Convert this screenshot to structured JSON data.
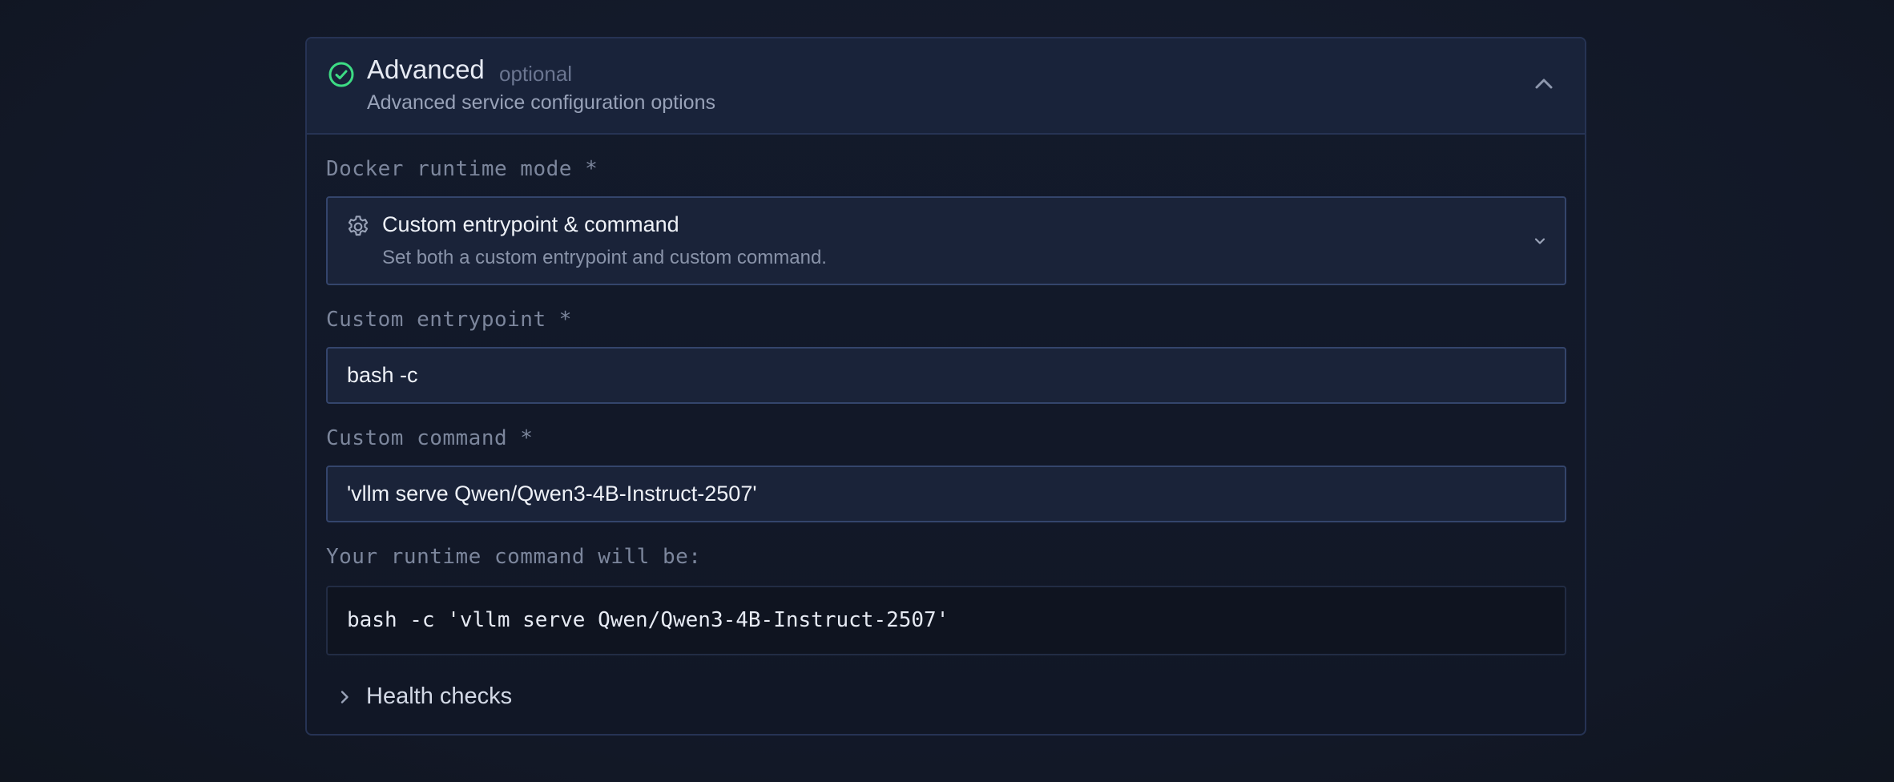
{
  "colors": {
    "accent_success": "#3ddc84",
    "border": "#263354",
    "input_border": "#34456c"
  },
  "section": {
    "title": "Advanced",
    "optional_tag": "optional",
    "description": "Advanced service configuration options",
    "status_icon": "check-circle-icon",
    "toggle_icon": "chevron-up-icon"
  },
  "runtime_mode": {
    "label": "Docker runtime mode *",
    "icon": "gear-icon",
    "selected_title": "Custom entrypoint & command",
    "selected_description": "Set both a custom entrypoint and custom command."
  },
  "entrypoint": {
    "label": "Custom entrypoint *",
    "value": "bash -c"
  },
  "command": {
    "label": "Custom command *",
    "value": "'vllm serve Qwen/Qwen3-4B-Instruct-2507'"
  },
  "preview": {
    "label": "Your runtime command will be:",
    "value": "bash -c 'vllm serve Qwen/Qwen3-4B-Instruct-2507'"
  },
  "health_checks": {
    "label": "Health checks"
  }
}
